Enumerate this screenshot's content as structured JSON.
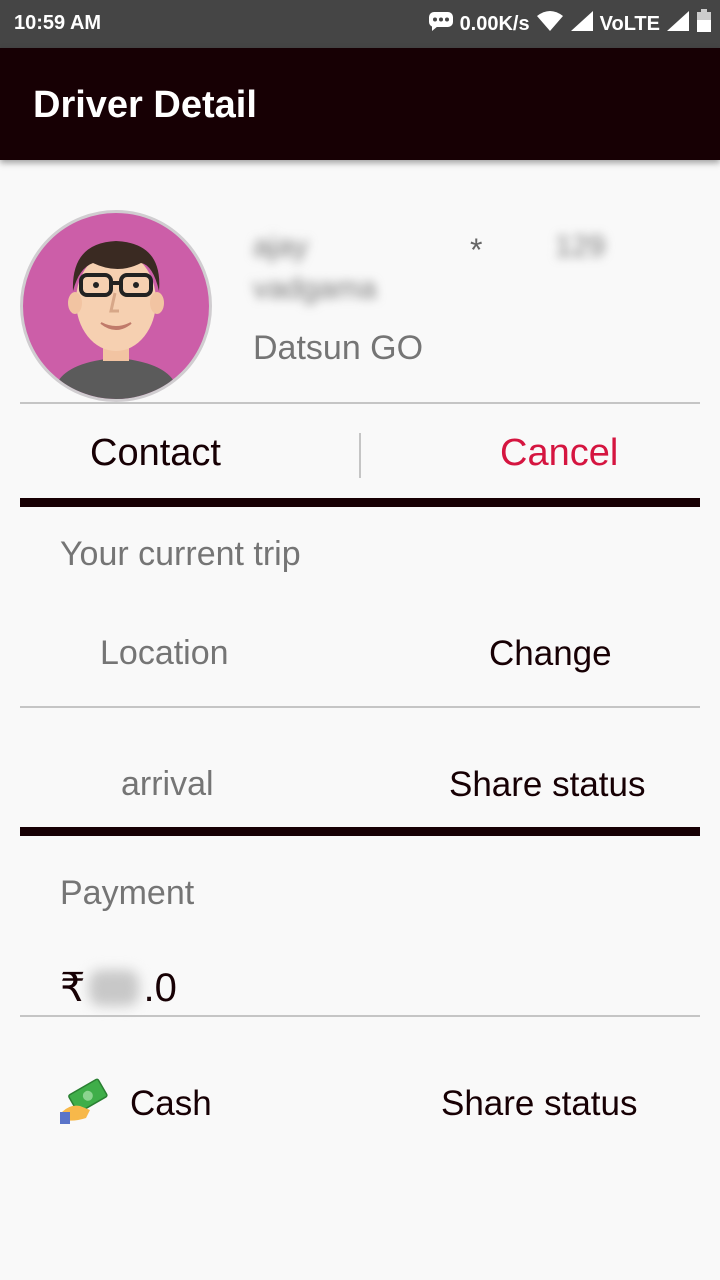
{
  "status_bar": {
    "time": "10:59 AM",
    "speed": "0.00K/s",
    "network": "VoLTE"
  },
  "app_bar": {
    "title": "Driver Detail"
  },
  "driver": {
    "name_line1": "ajay",
    "name_line2": "vadgama",
    "star": "*",
    "number": "129",
    "car_model": "Datsun GO"
  },
  "actions": {
    "contact_label": "Contact",
    "cancel_label": "Cancel"
  },
  "trip": {
    "heading": "Your current trip",
    "location_label": "Location",
    "change_label": "Change",
    "arrival_label": "arrival",
    "share_status_label": "Share status"
  },
  "payment": {
    "heading": "Payment",
    "currency_symbol": "₹",
    "amount_suffix": ".0",
    "method_label": "Cash",
    "share_status_label": "Share status"
  },
  "colors": {
    "appbar": "#170004",
    "status_bar": "#454545",
    "cancel": "#d51540",
    "avatar_bg": "#cc5ea8"
  }
}
